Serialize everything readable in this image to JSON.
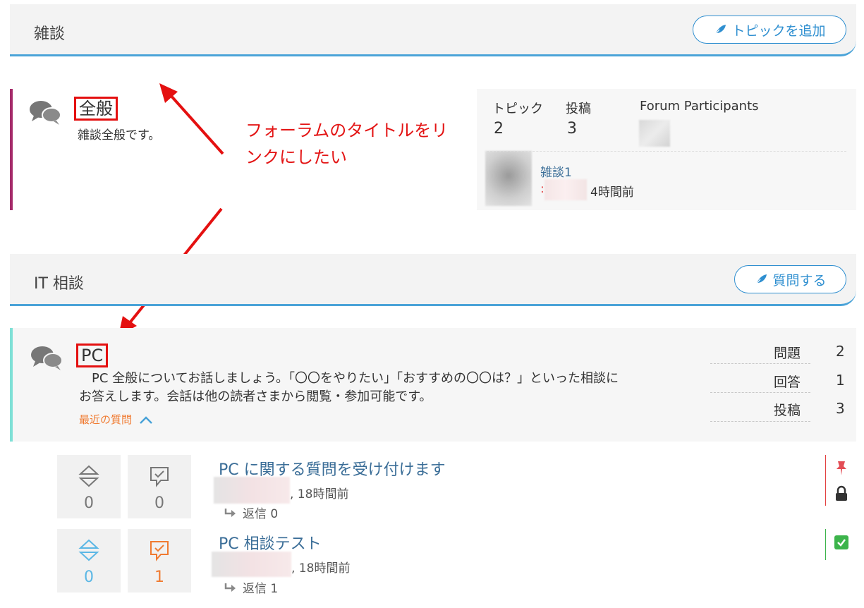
{
  "categories": [
    {
      "title": "雑談",
      "button": "トピックを追加"
    },
    {
      "title": "IT 相談",
      "button": "質問する"
    }
  ],
  "forum1": {
    "title": "全般",
    "description": "雑談全般です。",
    "stats": {
      "topics_label": "トピック",
      "topics": "2",
      "posts_label": "投稿",
      "posts": "3",
      "participants_label": "Forum Participants"
    },
    "last": {
      "topic": "雑談1",
      "prefix": ":",
      "time": "4時間前"
    }
  },
  "annotation": {
    "line1": "フォーラムのタイトルをリ",
    "line2": "ンクにしたい"
  },
  "forum2": {
    "title": "PC",
    "description_line1": "　PC 全般についてお話しましょう。「〇〇をやりたい」「おすすめの〇〇は？」といった相談に",
    "description_line2": "お答えします。会話は他の読者さまから閲覧・参加可能です。",
    "recent": "最近の質問",
    "stats": [
      {
        "label": "問題",
        "value": "2"
      },
      {
        "label": "回答",
        "value": "1"
      },
      {
        "label": "投稿",
        "value": "3"
      }
    ]
  },
  "topics": [
    {
      "title": "PC に関する質問を受け付けます",
      "votes": "0",
      "answers": "0",
      "time": ", 18時間前",
      "reply": "返信 0",
      "vote_color": "#777777",
      "answer_color": "#777777"
    },
    {
      "title": "PC 相談テスト",
      "votes": "0",
      "answers": "1",
      "time": ", 18時間前",
      "reply": "返信 1",
      "vote_color": "#5bb7e5",
      "answer_color": "#f07a30"
    }
  ]
}
